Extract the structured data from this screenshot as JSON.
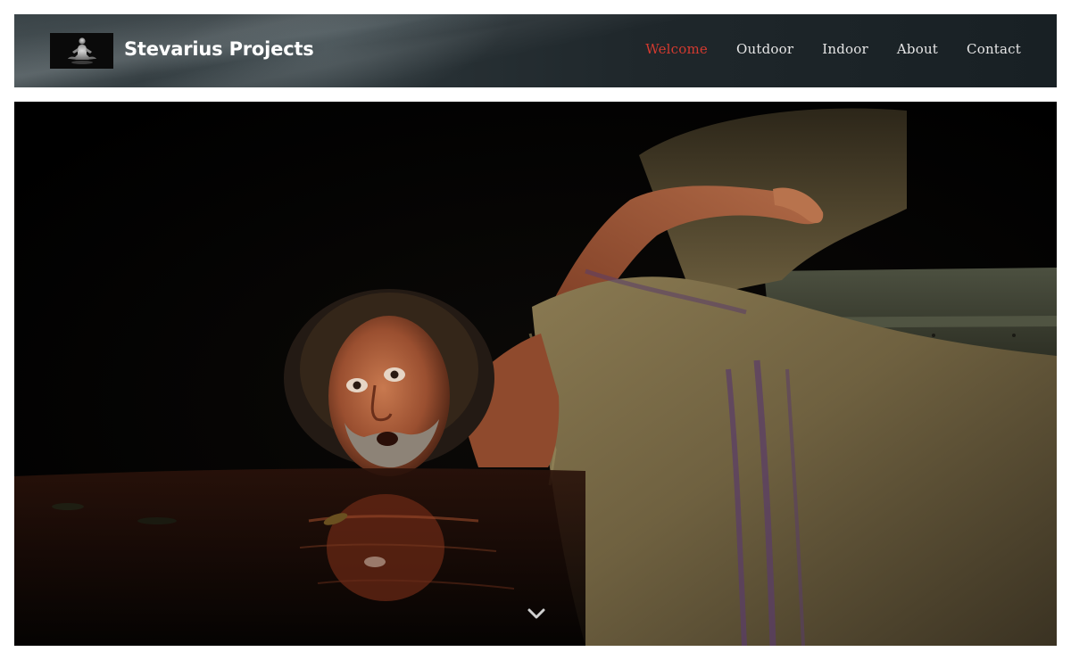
{
  "header": {
    "site_title": "Stevarius Projects",
    "logo_icon": "meditating-figure-icon"
  },
  "nav": {
    "items": [
      {
        "label": "Welcome",
        "active": true
      },
      {
        "label": "Outdoor",
        "active": false
      },
      {
        "label": "Indoor",
        "active": false
      },
      {
        "label": "About",
        "active": false
      },
      {
        "label": "Contact",
        "active": false
      }
    ]
  },
  "hero": {
    "scroll_icon": "chevron-down-icon"
  },
  "colors": {
    "accent_active_nav": "#d33a2f",
    "nav_text": "#e6e6e6",
    "title_text": "#ffffff",
    "hero_background": "#040404"
  }
}
